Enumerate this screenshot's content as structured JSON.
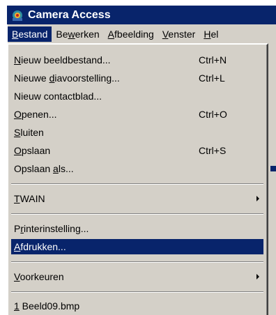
{
  "window": {
    "title": "Camera Access"
  },
  "menubar": {
    "items": [
      {
        "pre": "",
        "key": "B",
        "post": "estand"
      },
      {
        "pre": "Be",
        "key": "w",
        "post": "erken"
      },
      {
        "pre": "",
        "key": "A",
        "post": "fbeelding"
      },
      {
        "pre": "",
        "key": "V",
        "post": "enster"
      },
      {
        "pre": "",
        "key": "H",
        "post": "el"
      }
    ]
  },
  "menu": {
    "new_image": {
      "pre": "",
      "key": "N",
      "post": "ieuw beeldbestand...",
      "shortcut": "Ctrl+N"
    },
    "new_slideshow": {
      "pre": "Nieuwe ",
      "key": "d",
      "post": "iavoorstelling...",
      "shortcut": "Ctrl+L"
    },
    "new_contact_sheet": {
      "pre": "Nieuw contactblad...",
      "key": "",
      "post": ""
    },
    "open": {
      "pre": "",
      "key": "O",
      "post": "penen...",
      "shortcut": "Ctrl+O"
    },
    "close": {
      "pre": "",
      "key": "S",
      "post": "luiten"
    },
    "save": {
      "pre": "",
      "key": "O",
      "post": "pslaan",
      "shortcut": "Ctrl+S"
    },
    "save_as": {
      "pre": "Opslaan ",
      "key": "a",
      "post": "ls..."
    },
    "twain": {
      "pre": "",
      "key": "T",
      "post": "WAIN"
    },
    "printer_setup": {
      "pre": "P",
      "key": "r",
      "post": "interinstelling..."
    },
    "print": {
      "pre": "",
      "key": "A",
      "post": "fdrukken..."
    },
    "preferences": {
      "pre": "",
      "key": "V",
      "post": "oorkeuren"
    },
    "recent_1": {
      "pre": "",
      "key": "1",
      "post": " Beeld09.bmp"
    }
  }
}
